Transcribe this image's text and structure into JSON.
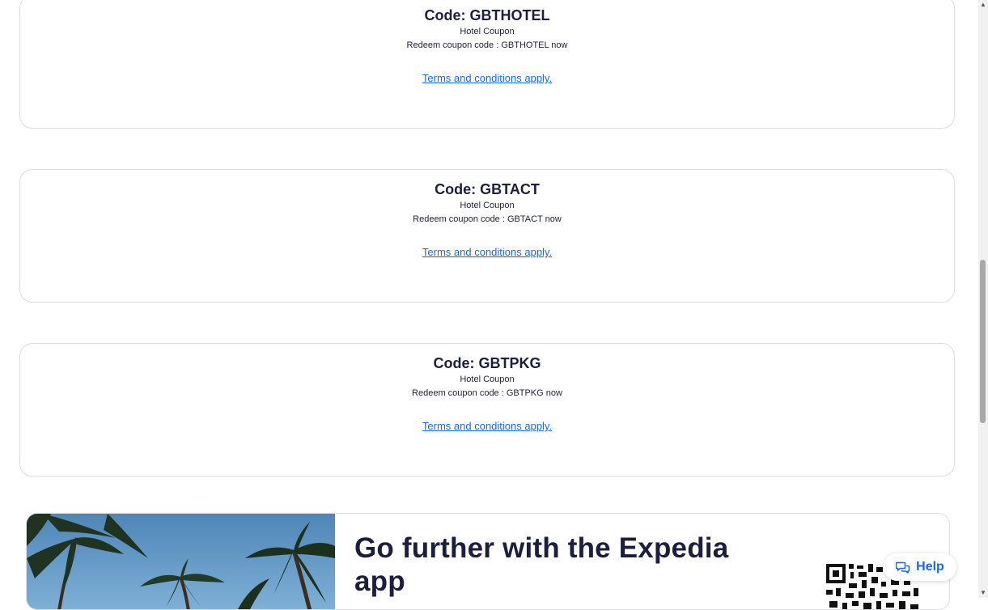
{
  "coupons": [
    {
      "title": "Code: GBTHOTEL",
      "type": "Hotel Coupon",
      "description": "Redeem coupon code : GBTHOTEL now",
      "terms": "Terms and conditions apply."
    },
    {
      "title": "Code: GBTACT",
      "type": "Hotel Coupon",
      "description": "Redeem coupon code : GBTACT now",
      "terms": "Terms and conditions apply."
    },
    {
      "title": "Code: GBTPKG",
      "type": "Hotel Coupon",
      "description": "Redeem coupon code : GBTPKG now",
      "terms": "Terms and conditions apply."
    }
  ],
  "app_banner": {
    "heading": "Go further with the Expedia app"
  },
  "help": {
    "label": "Help",
    "icon": "chat-bubbles-icon"
  },
  "colors": {
    "link": "#1668e3",
    "heading": "#1b1e3d",
    "border": "#dcdce2"
  }
}
